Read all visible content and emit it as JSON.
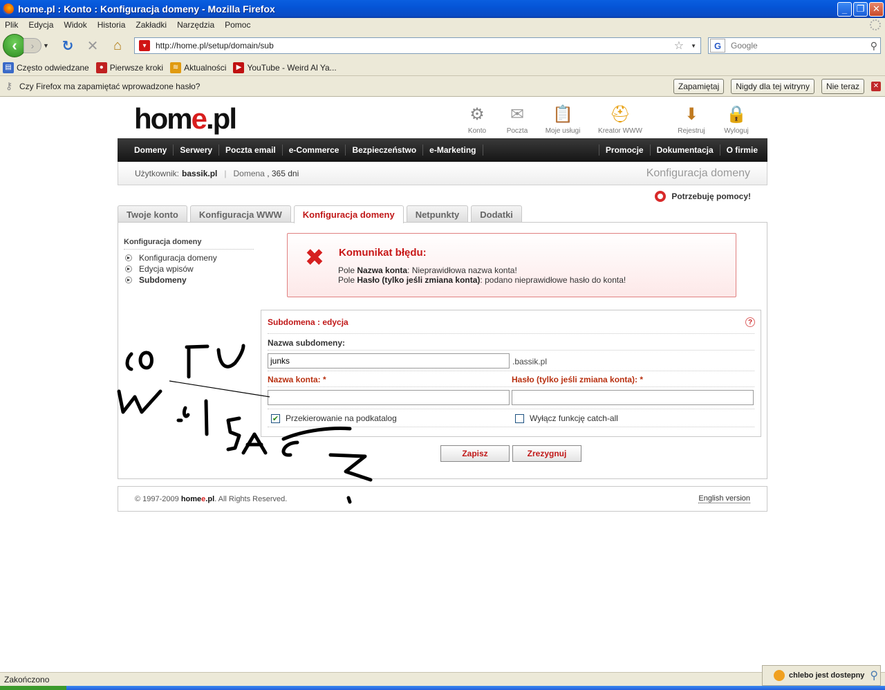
{
  "window": {
    "title": "home.pl : Konto : Konfiguracja domeny - Mozilla Firefox",
    "buttons": {
      "minimize": "_",
      "maximize": "❐",
      "close": "✕"
    }
  },
  "menu": [
    "Plik",
    "Edycja",
    "Widok",
    "Historia",
    "Zakładki",
    "Narzędzia",
    "Pomoc"
  ],
  "navbar": {
    "url": "http://home.pl/setup/domain/sub",
    "search_placeholder": "Google"
  },
  "bookmarks": [
    {
      "label": "Często odwiedzane",
      "icon": "bookmark-folder-icon",
      "color": "#3a6ac8"
    },
    {
      "label": "Pierwsze kroki",
      "icon": "firefox-icon",
      "color": "#c02020"
    },
    {
      "label": "Aktualności",
      "icon": "rss-icon",
      "color": "#e09a10"
    },
    {
      "label": "YouTube - Weird Al Ya...",
      "icon": "youtube-icon",
      "color": "#c01010"
    }
  ],
  "notification": {
    "message": "Czy Firefox ma zapamiętać wprowadzone hasło?",
    "remember": "Zapamiętaj",
    "never": "Nigdy dla tej witryny",
    "not_now": "Nie teraz"
  },
  "site": {
    "logo": {
      "home": "hom",
      "e": "e",
      "pl": ".pl"
    },
    "top_icons": [
      "Konto",
      "Poczta",
      "Moje usługi",
      "Kreator WWW",
      "Rejestruj",
      "Wyloguj"
    ],
    "nav_left": [
      "Domeny",
      "Serwery",
      "Poczta email",
      "e-Commerce",
      "Bezpieczeństwo",
      "e-Marketing"
    ],
    "nav_right": [
      "Promocje",
      "Dokumentacja",
      "O firmie"
    ],
    "user_label": "Użytkownik:",
    "user_value": "bassik.pl",
    "domain_label": "Domena",
    "domain_value": ", 365 dni",
    "page_title": "Konfiguracja domeny",
    "help": "Potrzebuję pomocy!",
    "tabs": [
      "Twoje konto",
      "Konfiguracja WWW",
      "Konfiguracja domeny",
      "Netpunkty",
      "Dodatki"
    ],
    "active_tab": 2
  },
  "sidemenu": {
    "heading": "Konfiguracja domeny",
    "items": [
      "Konfiguracja domeny",
      "Edycja wpisów",
      "Subdomeny"
    ],
    "active": 2
  },
  "error": {
    "title": "Komunikat błędu:",
    "line1_pre": "Pole ",
    "line1_bold": "Nazwa konta",
    "line1_post": ": Nieprawidłowa nazwa konta!",
    "line2_pre": "Pole ",
    "line2_bold": "Hasło (tylko jeśli zmiana konta)",
    "line2_post": ": podano nieprawidłowe hasło do konta!"
  },
  "form": {
    "title": "Subdomena : edycja",
    "help_icon": "?",
    "subdomain_label": "Nazwa subdomeny:",
    "subdomain_value": "junks",
    "suffix": ".bassik.pl",
    "account_label": "Nazwa konta: *",
    "account_value": "",
    "password_label": "Hasło (tylko jeśli zmiana konta): *",
    "password_value": "",
    "redirect_label": "Przekierowanie na podkatalog",
    "redirect_checked": true,
    "catchall_label": "Wyłącz funkcję catch-all",
    "catchall_checked": false,
    "save": "Zapisz",
    "cancel": "Zrezygnuj"
  },
  "footer": {
    "copy_pre": "© 1997-2009 ",
    "brand_home": "home",
    "brand_e": "e",
    "brand_pl": ".pl",
    "copy_post": ". All Rights Reserved.",
    "english": "English version"
  },
  "status": {
    "text": "Zakończono",
    "gadget": "chlebo jest dostepny"
  }
}
